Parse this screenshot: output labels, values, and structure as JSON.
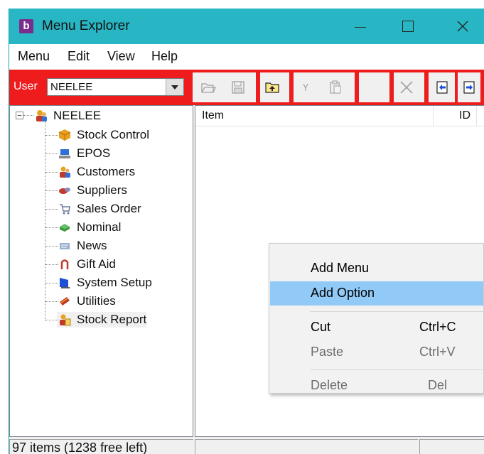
{
  "window": {
    "icon_letter": "b",
    "title": "Menu Explorer",
    "title_bar_color": "#29b6c4",
    "highlight_color": "#ee1c1c"
  },
  "menubar": {
    "items": [
      "Menu",
      "Edit",
      "View",
      "Help"
    ]
  },
  "toolbar": {
    "user_label": "User",
    "user_value": "NEELEE",
    "buttons": [
      "open-folder-icon",
      "save-disk-icon",
      "up-folder-icon",
      "filter-icon",
      "paste-clipboard-icon",
      "blank",
      "delete-x-icon",
      "import-icon",
      "export-icon"
    ]
  },
  "tree": {
    "root": {
      "label": "NEELEE",
      "icon": "user-group-icon",
      "expander": "−"
    },
    "items": [
      {
        "label": "Stock Control",
        "icon": "box-icon"
      },
      {
        "label": "EPOS",
        "icon": "pos-terminal-icon"
      },
      {
        "label": "Customers",
        "icon": "customers-icon"
      },
      {
        "label": "Suppliers",
        "icon": "suppliers-icon"
      },
      {
        "label": "Sales Order",
        "icon": "cart-icon"
      },
      {
        "label": "Nominal",
        "icon": "ledger-icon"
      },
      {
        "label": "News",
        "icon": "news-icon"
      },
      {
        "label": "Gift Aid",
        "icon": "gift-icon"
      },
      {
        "label": "System Setup",
        "icon": "monitor-icon"
      },
      {
        "label": "Utilities",
        "icon": "tools-icon"
      },
      {
        "label": "Stock Report",
        "icon": "report-icon"
      }
    ]
  },
  "list": {
    "columns": [
      "Item",
      "ID"
    ]
  },
  "context_menu": {
    "items": [
      {
        "label": "Add Menu",
        "shortcut": ""
      },
      {
        "label": "Add Option",
        "shortcut": ""
      },
      {
        "label": "Cut",
        "shortcut": "Ctrl+C"
      },
      {
        "label": "Paste",
        "shortcut": "Ctrl+V"
      },
      {
        "label": "Delete",
        "shortcut": "Del"
      }
    ],
    "highlighted": "Add Option",
    "highlight_color": "#91c9f7"
  },
  "status": {
    "text": "97 items  (1238 free left)"
  }
}
